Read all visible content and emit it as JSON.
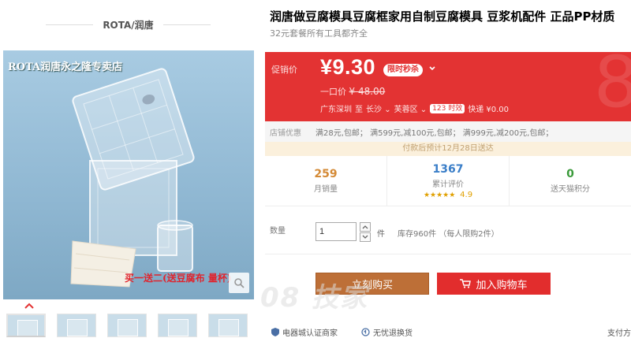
{
  "store": {
    "name": "ROTA/润唐"
  },
  "gallery": {
    "banner": "ROTA润唐永之隆专卖店",
    "gift_text": "买一送二(送豆腐布 量杯)",
    "thumb_count": 5
  },
  "product": {
    "title": "润唐做豆腐模具豆腐框家用自制豆腐模具 豆浆机配件 正品PP材质",
    "subtitle": "32元套餐所有工具都齐全"
  },
  "price": {
    "promo_label": "促销价",
    "value": "¥9.30",
    "flash_badge": "限时秒杀",
    "original_label": "一口价",
    "original_value": "¥ 48.00",
    "deco": "8"
  },
  "shipping": {
    "from": "广东深圳",
    "to_word": "至",
    "city": "长沙",
    "district": "芙蓉区",
    "timing": "123 时效",
    "fee": "快递 ¥0.00"
  },
  "shop_promo": {
    "label": "店铺优惠",
    "text": "满28元,包邮； 满599元,减100元,包邮； 满999元,减200元,包邮；"
  },
  "delivery_note": "付款后预计12月28日送达",
  "stats": {
    "monthly_sales": "259",
    "monthly_sales_label": "月销量",
    "reviews": "1367",
    "reviews_label": "累计评价",
    "rating_stars": "★★★★★",
    "rating": "4.9",
    "points": "0",
    "points_label": "送天猫积分"
  },
  "quantity": {
    "label": "数量",
    "value": "1",
    "unit": "件",
    "stock": "库存960件 （每人限购2件）"
  },
  "actions": {
    "buy": "立刻购买",
    "cart": "加入购物车"
  },
  "watermark": "08 技家",
  "assurances": {
    "cert": "电器城认证商家",
    "return": "无忧退换货",
    "pay": "支付方"
  },
  "colors": {
    "price_panel": "#e33333",
    "buy_button": "#bd6f37",
    "cart_button": "#e22d2d"
  }
}
